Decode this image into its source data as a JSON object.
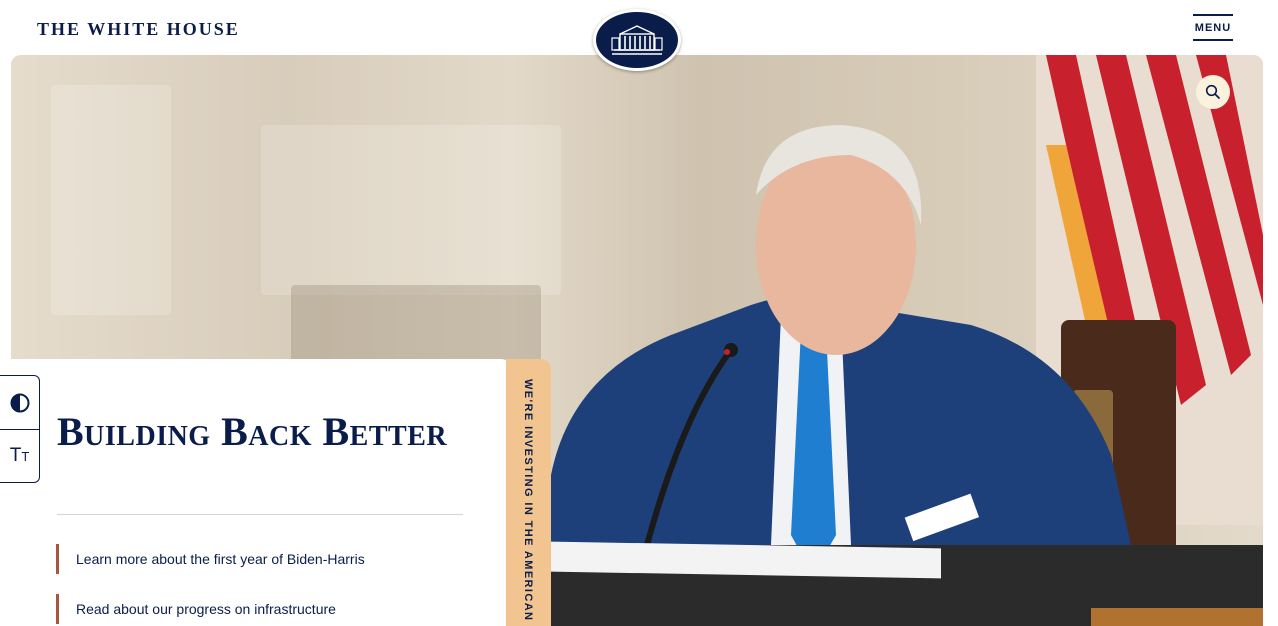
{
  "header": {
    "site_title": "THE WHITE HOUSE",
    "menu_label": "MENU"
  },
  "hero": {
    "headline": "Building Back Better",
    "ribbon_text": "WE'RE INVESTING IN THE AMERICAN PE",
    "links": [
      {
        "label": "Learn more about the first year of Biden-Harris"
      },
      {
        "label": "Read about our progress on infrastructure"
      }
    ]
  },
  "accessibility": {
    "contrast_icon": "contrast-icon",
    "text_size_glyph": "Tт"
  },
  "icons": {
    "search": "search-icon",
    "seal": "white-house-seal-icon"
  },
  "colors": {
    "navy": "#0a1d4a",
    "ribbon": "#f2c590",
    "link_accent": "#a8543f",
    "search_bg": "#fbf2dd"
  }
}
